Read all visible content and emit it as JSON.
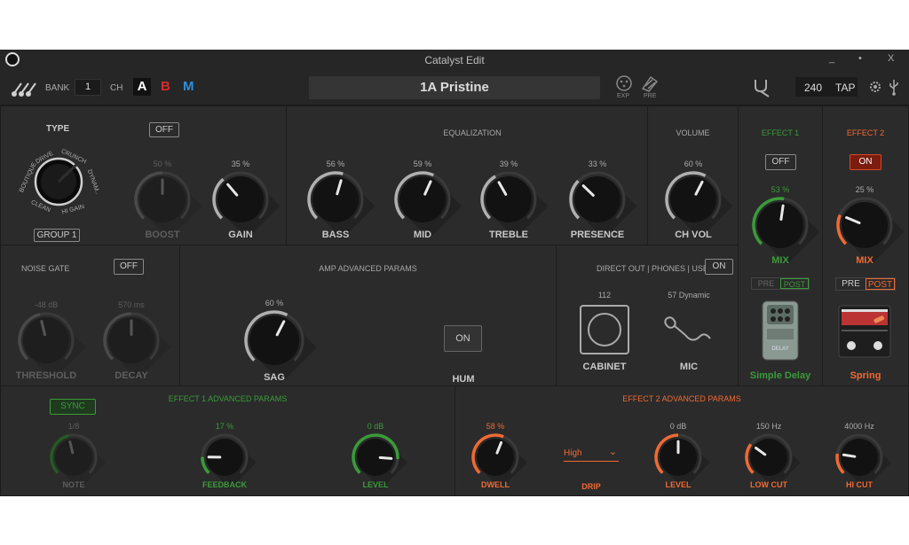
{
  "window": {
    "title": "Catalyst Edit",
    "minimize": "_",
    "maximize": "•",
    "close": "X"
  },
  "toolbar": {
    "bank_label": "BANK",
    "bank_value": "1",
    "ch_label": "CH",
    "ch_a": "A",
    "ch_b": "B",
    "ch_m": "M",
    "preset_name": "1A Pristine",
    "exp_label": "EXP",
    "pre_label": "PRE",
    "tempo": "240",
    "tap": "TAP"
  },
  "amp": {
    "type_label": "TYPE",
    "type_options": [
      "BOUTIQUE",
      "DRIVE",
      "CRUNCH",
      "DYNAM..",
      "HI GAIN",
      "CLEAN"
    ],
    "group": "GROUP 1",
    "boost_toggle": "OFF",
    "boost": {
      "label": "BOOST",
      "value": "50 %",
      "level": 0.5
    },
    "gain": {
      "label": "GAIN",
      "value": "35 %",
      "level": 0.35
    }
  },
  "eq": {
    "title": "EQUALIZATION",
    "bass": {
      "label": "BASS",
      "value": "56 %",
      "level": 0.56
    },
    "mid": {
      "label": "MID",
      "value": "59 %",
      "level": 0.59
    },
    "treble": {
      "label": "TREBLE",
      "value": "39 %",
      "level": 0.39
    },
    "presence": {
      "label": "PRESENCE",
      "value": "33 %",
      "level": 0.33
    }
  },
  "volume": {
    "title": "VOLUME",
    "label": "CH VOL",
    "value": "60 %",
    "level": 0.6
  },
  "noise_gate": {
    "title": "NOISE GATE",
    "toggle": "OFF",
    "threshold": {
      "label": "THRESHOLD",
      "value": "-48 dB",
      "level": 0.45
    },
    "decay": {
      "label": "DECAY",
      "value": "570 ms",
      "level": 0.5
    }
  },
  "amp_adv": {
    "title": "AMP ADVANCED PARAMS",
    "sag": {
      "label": "SAG",
      "value": "60 %",
      "level": 0.6
    },
    "hum_toggle": "ON",
    "hum_label": "HUM"
  },
  "direct_out": {
    "title": "DIRECT OUT | PHONES | USB",
    "toggle": "ON",
    "cab_value": "112",
    "cab_label": "CABINET",
    "mic_value": "57 Dynamic",
    "mic_label": "MIC"
  },
  "effect1": {
    "title": "EFFECT 1",
    "toggle": "OFF",
    "mix_value": "53 %",
    "mix_level": 0.53,
    "mix_label": "MIX",
    "pre": "PRE",
    "post": "POST",
    "pedal_text": "DELAY",
    "name": "Simple Delay"
  },
  "effect2": {
    "title": "EFFECT 2",
    "toggle": "ON",
    "mix_value": "25 %",
    "mix_level": 0.25,
    "mix_label": "MIX",
    "pre": "PRE",
    "post": "POST",
    "name": "Spring"
  },
  "fx1_adv": {
    "title": "EFFECT 1 ADVANCED PARAMS",
    "sync": "SYNC",
    "note": {
      "label": "NOTE",
      "value": "1/8",
      "level": 0.45
    },
    "feedback": {
      "label": "FEEDBACK",
      "value": "17 %",
      "level": 0.17
    },
    "level": {
      "label": "LEVEL",
      "value": "0 dB",
      "level": 0.85
    }
  },
  "fx2_adv": {
    "title": "EFFECT 2 ADVANCED PARAMS",
    "dwell": {
      "label": "DWELL",
      "value": "58 %",
      "level": 0.58
    },
    "drip": {
      "label": "DRIP",
      "value": "High"
    },
    "level": {
      "label": "LEVEL",
      "value": "0 dB",
      "level": 0.5
    },
    "low_cut": {
      "label": "LOW CUT",
      "value": "150 Hz",
      "level": 0.3
    },
    "hi_cut": {
      "label": "HI CUT",
      "value": "4000 Hz",
      "level": 0.2
    }
  },
  "colors": {
    "green": "#3a9b3a",
    "orange": "#ef6a33",
    "arc": "#b0b0b0",
    "dim_arc": "#4a4a4a"
  }
}
